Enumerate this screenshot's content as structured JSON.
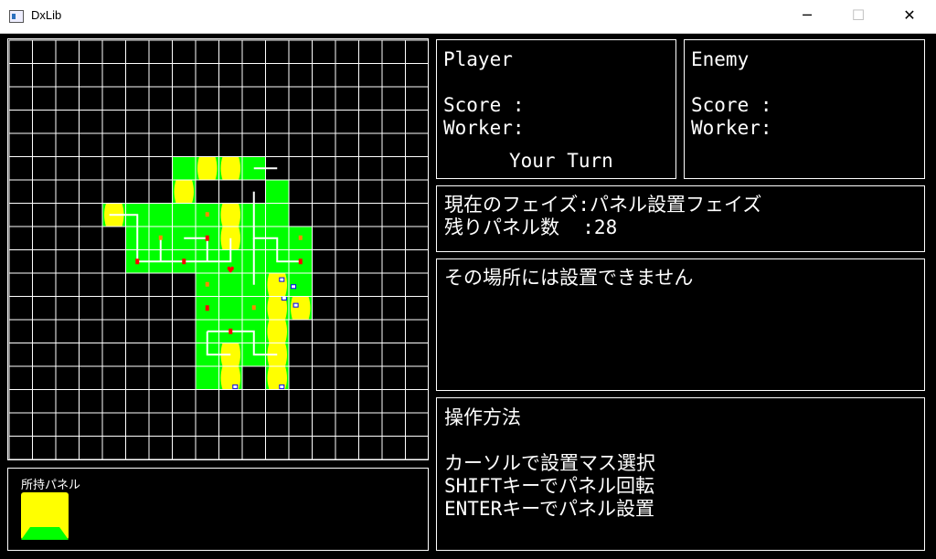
{
  "window": {
    "title": "DxLib",
    "minimize": "─",
    "maximize": "☐",
    "close": "✕"
  },
  "board": {
    "cols": 18,
    "rows": 18
  },
  "player": {
    "title": "Player",
    "score_label": "Score :",
    "worker_label": "Worker:",
    "turn_text": "Your Turn"
  },
  "enemy": {
    "title": "Enemy",
    "score_label": "Score :",
    "worker_label": "Worker:"
  },
  "phase": {
    "line1": "現在のフェイズ:パネル設置フェイズ",
    "line2": "残りパネル数  :28"
  },
  "message": {
    "text": "その場所には設置できません"
  },
  "howto": {
    "title": "操作方法",
    "lines": [
      "カーソルで設置マス選択",
      "SHIFTキーでパネル回転",
      "ENTERキーでパネル設置"
    ]
  },
  "owned": {
    "label": "所持パネル"
  },
  "colors": {
    "grass": "#00ff00",
    "city": "#ffff00",
    "road": "#ffffff",
    "grid": "#ffffff",
    "bg": "#000000"
  }
}
